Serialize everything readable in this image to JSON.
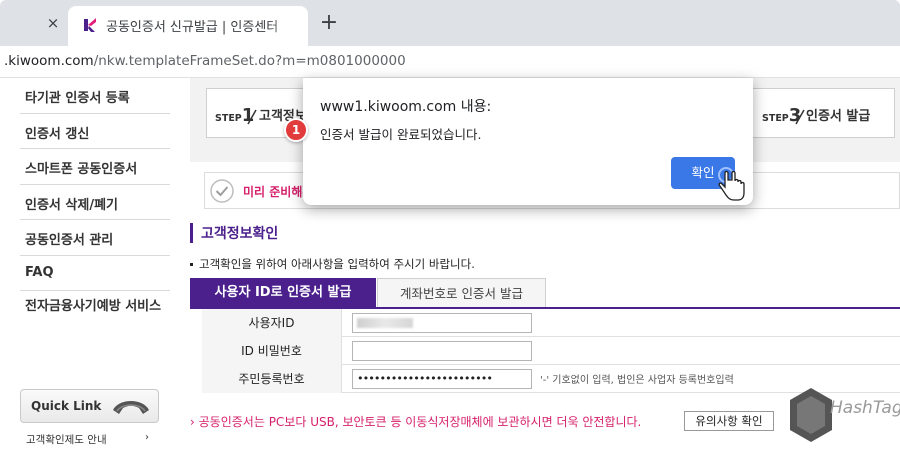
{
  "browser": {
    "tab_title": "공동인증서 신규발급 | 인증센터",
    "url_host": ".kiwoom.com",
    "url_path": "/nkw.templateFrameSet.do?m=m0801000000",
    "new_tab_symbol": "+",
    "close_symbol": "×"
  },
  "sidebar": {
    "items": [
      {
        "label": "타기관 인증서 등록"
      },
      {
        "label": "인증서 갱신"
      },
      {
        "label": "스마트폰 공동인증서"
      },
      {
        "label": "인증서 삭제/폐기"
      },
      {
        "label": "공동인증서 관리"
      },
      {
        "label": "FAQ"
      },
      {
        "label": "전자금융사기예방 서비스"
      }
    ],
    "quick_link": "Quick Link",
    "quick_sub": "고객확인제도 안내",
    "quick_sub_arrow": "›"
  },
  "steps": {
    "step1_prefix": "STEP",
    "step1_num": "1",
    "step1_label": "고객정보",
    "step3_prefix": "STEP",
    "step3_num": "3",
    "step3_label": "인증서 발급"
  },
  "notice": {
    "text": "미리 준비해주"
  },
  "section": {
    "title": "고객정보확인",
    "desc": "고객확인을 위하여 아래사항을 입력하여 주시기 바랍니다."
  },
  "tabs": {
    "active": "사용자 ID로 인증서 발급",
    "inactive": "계좌번호로 인증서 발급"
  },
  "form": {
    "rows": [
      {
        "label": "사용자ID",
        "value": ""
      },
      {
        "label": "ID 비밀번호",
        "value": ""
      },
      {
        "label": "주민등록번호",
        "value": "••••••••••••••••••••••••",
        "hint": "'-' 기호없이 입력, 법인은 사업자 등록번호입력"
      }
    ]
  },
  "warning": {
    "text": "공동인증서는 PC보다 USB, 보안토큰 등 이동식저장매체에 보관하시면 더욱 안전합니다.",
    "arrow": "›",
    "button": "유의사항 확인"
  },
  "watermark": {
    "text": "HashTag"
  },
  "dialog": {
    "title": "www1.kiwoom.com 내용:",
    "message": "인증서 발급이 완료되었습니다.",
    "ok_button": "확인",
    "badge": "1"
  },
  "colors": {
    "brand_purple": "#4b1f8c",
    "accent_pink": "#d6206b",
    "dialog_button": "#3b78e7",
    "badge_red": "#e23b3b"
  }
}
